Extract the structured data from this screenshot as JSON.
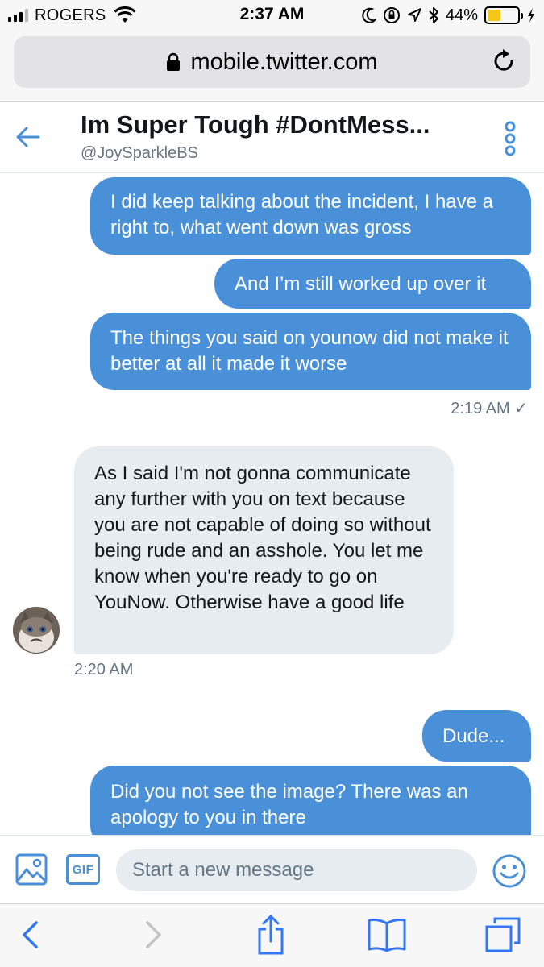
{
  "status_bar": {
    "carrier": "ROGERS",
    "time": "2:37 AM",
    "battery_percent": "44%",
    "battery_level": 0.44,
    "signal_bars_active": 3,
    "signal_bars_total": 4
  },
  "browser": {
    "url": "mobile.twitter.com"
  },
  "conversation": {
    "name": "Im Super Tough #DontMess...",
    "handle": "@JoySparkleBS"
  },
  "messages": [
    {
      "direction": "outgoing",
      "text": "I did keep talking about the incident, I have a right to, what went down was gross"
    },
    {
      "direction": "outgoing",
      "text": "And I’m still worked up over it"
    },
    {
      "direction": "outgoing",
      "text": "The things you said on younow did not make it better at all it made it worse"
    },
    {
      "direction": "meta",
      "text": "2:19 AM ✓"
    },
    {
      "direction": "incoming",
      "text": "As I said I'm not gonna communicate any further with you on text because you are not capable of doing so without being rude and an asshole. You let me know when you're ready to go on YouNow. Otherwise have a good life"
    },
    {
      "direction": "meta",
      "text": "2:20 AM"
    },
    {
      "direction": "outgoing",
      "text": "Dude..."
    },
    {
      "direction": "outgoing",
      "text": "Did you not see the image? There was an apology to you in there"
    }
  ],
  "composer": {
    "gif_label": "GIF",
    "placeholder": "Start a new message"
  },
  "colors": {
    "accent": "#4a90d9",
    "incoming_bubble": "#e6ecf0",
    "secondary_text": "#657786",
    "battery_fill": "#f5c518"
  },
  "icons": {
    "status": [
      "signal-icon",
      "wifi-icon",
      "moon-icon",
      "rotation-lock-icon",
      "location-icon",
      "bluetooth-icon",
      "battery-icon",
      "charging-icon"
    ],
    "browser": [
      "lock-icon",
      "reload-icon"
    ],
    "header": [
      "back-arrow-icon",
      "more-vertical-icon"
    ],
    "composer": [
      "image-icon",
      "gif-icon",
      "emoji-icon"
    ],
    "toolbar": [
      "back-chevron-icon",
      "forward-chevron-icon",
      "share-icon",
      "bookmarks-icon",
      "tabs-icon"
    ]
  }
}
